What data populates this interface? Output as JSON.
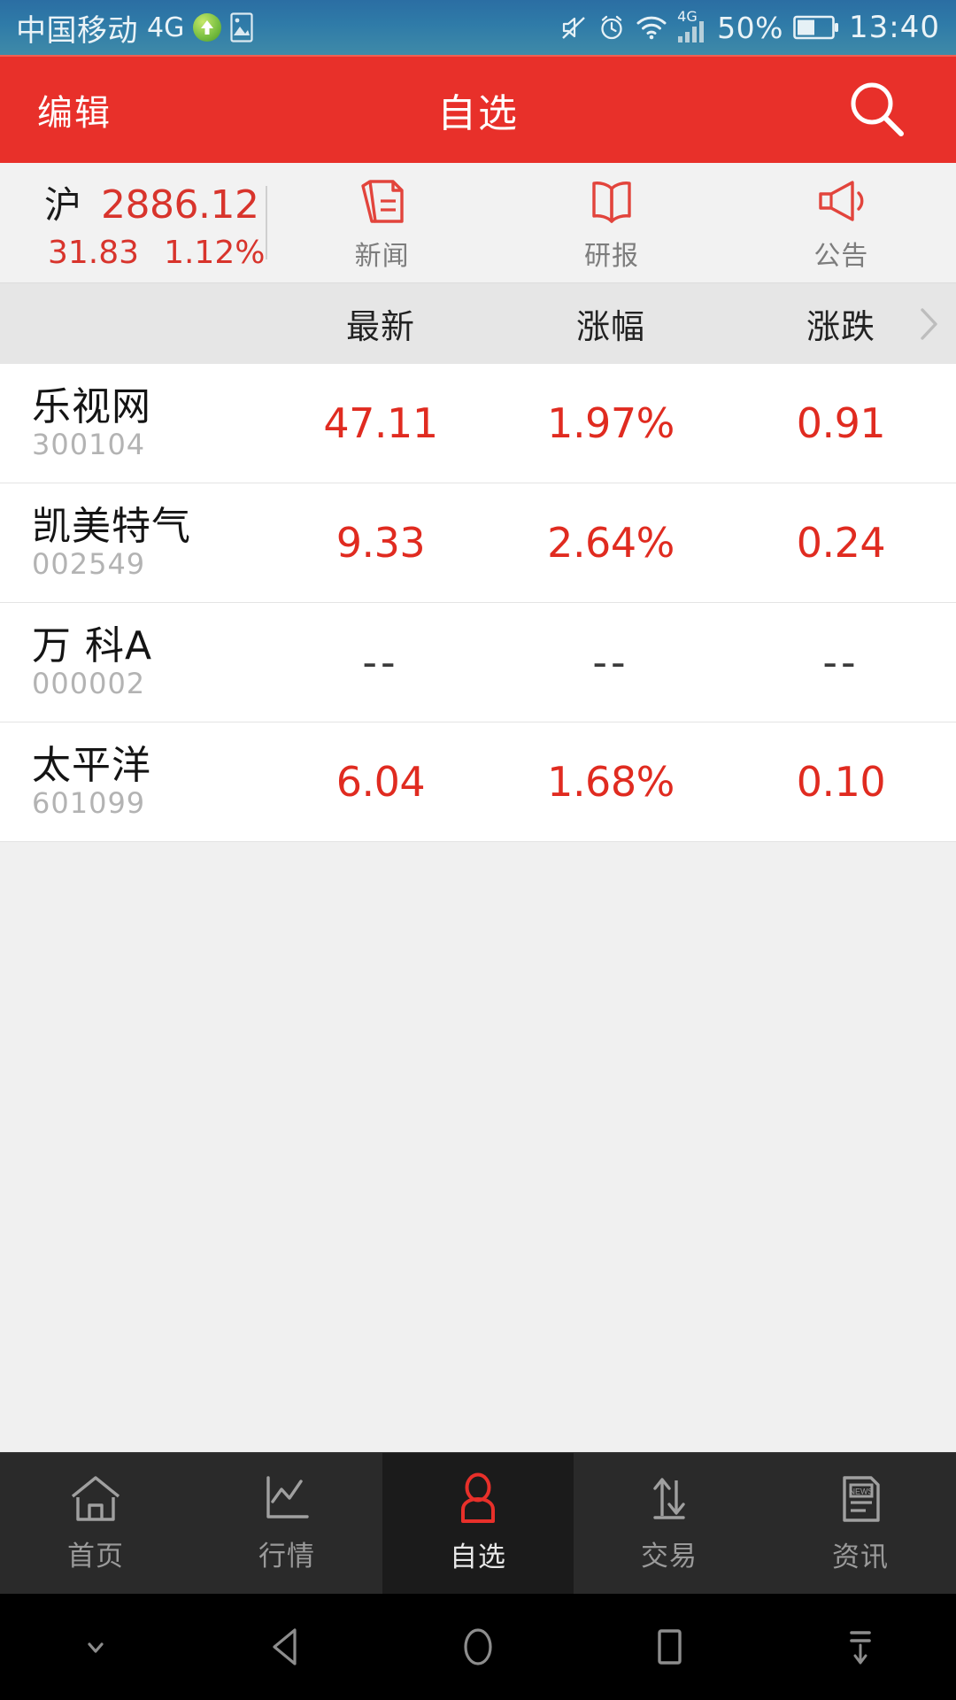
{
  "statusbar": {
    "carrier": "中国移动",
    "network": "4G",
    "battery_percent": "50%",
    "clock": "13:40",
    "icons": {
      "uplink": "up-arrow-circle-icon",
      "screenshot": "screenshot-icon",
      "mute": "mute-icon",
      "alarm": "alarm-icon",
      "wifi": "wifi-icon",
      "signal": "signal-bars-icon",
      "battery": "battery-icon"
    }
  },
  "appbar": {
    "edit_label": "编辑",
    "title": "自选",
    "search_icon": "search-icon",
    "bg_color": "#e8302a"
  },
  "index": {
    "name": "沪",
    "value": "2886.12",
    "change": "31.83",
    "change_percent": "1.12%",
    "color": "#d8342c"
  },
  "shortcuts": [
    {
      "icon": "news-document-icon",
      "label": "新闻"
    },
    {
      "icon": "open-book-icon",
      "label": "研报"
    },
    {
      "icon": "megaphone-icon",
      "label": "公告"
    }
  ],
  "table": {
    "headers": [
      "最新",
      "涨幅",
      "涨跌"
    ],
    "more_icon": "chevron-right-icon",
    "rows": [
      {
        "name": "乐视网",
        "code": "300104",
        "last": "47.11",
        "pct": "1.97%",
        "chg": "0.91",
        "state": "up"
      },
      {
        "name": "凯美特气",
        "code": "002549",
        "last": "9.33",
        "pct": "2.64%",
        "chg": "0.24",
        "state": "up"
      },
      {
        "name": "万 科A",
        "code": "000002",
        "last": "--",
        "pct": "--",
        "chg": "--",
        "state": "flat"
      },
      {
        "name": "太平洋",
        "code": "601099",
        "last": "6.04",
        "pct": "1.68%",
        "chg": "0.10",
        "state": "up"
      }
    ]
  },
  "tabs": [
    {
      "icon": "home-icon",
      "label": "首页",
      "active": false
    },
    {
      "icon": "market-chart-icon",
      "label": "行情",
      "active": false
    },
    {
      "icon": "person-icon",
      "label": "自选",
      "active": true
    },
    {
      "icon": "trade-arrows-icon",
      "label": "交易",
      "active": false
    },
    {
      "icon": "news-paper-icon",
      "label": "资讯",
      "active": false
    }
  ],
  "navbar": {
    "buttons": [
      "chevron-down-icon",
      "back-triangle-icon",
      "home-circle-icon",
      "recents-square-icon",
      "pulldown-icon"
    ]
  },
  "colors": {
    "accent_red": "#e8302a",
    "up_red": "#e02b20",
    "status_blue": "#2f7ba8"
  }
}
